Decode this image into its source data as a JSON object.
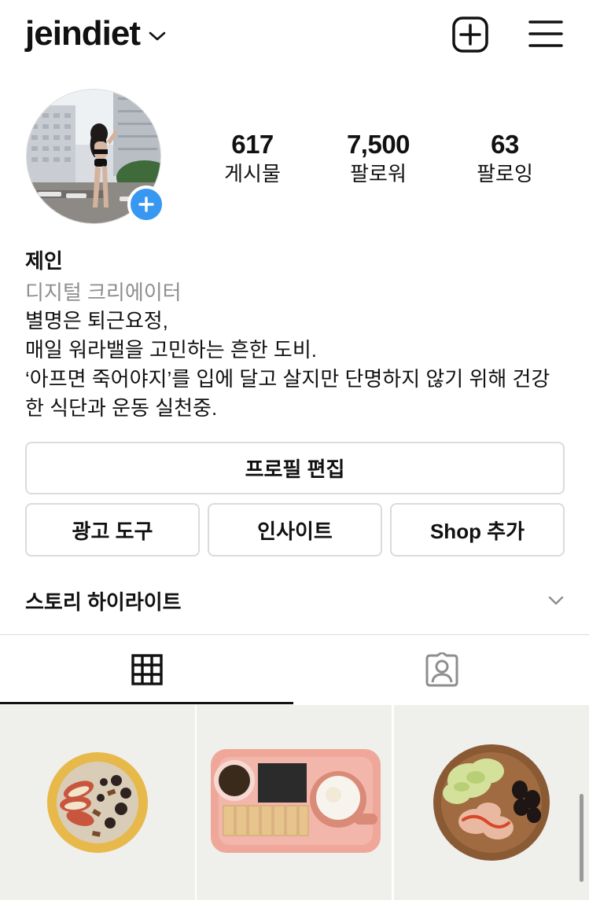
{
  "header": {
    "username": "jeindiet"
  },
  "stats": {
    "posts": {
      "value": "617",
      "label": "게시물"
    },
    "followers": {
      "value": "7,500",
      "label": "팔로워"
    },
    "following": {
      "value": "63",
      "label": "팔로잉"
    }
  },
  "bio": {
    "name": "제인",
    "category": "디지털 크리에이터",
    "lines": [
      "별명은 퇴근요정,",
      "매일 워라밸을 고민하는 흔한 도비.",
      "‘아프면 죽어야지’를 입에 달고 살지만 단명하지 않기 위해 건강",
      "한 식단과 운동 실천중."
    ]
  },
  "buttons": {
    "edit_profile": "프로필 편집",
    "ad_tools": "광고 도구",
    "insights": "인사이트",
    "add_shop": "Shop 추가"
  },
  "highlights": {
    "label": "스토리 하이라이트"
  },
  "colors": {
    "accent_blue": "#3897f0",
    "border": "#dbdbdb",
    "muted_text": "#8e8e8e"
  },
  "icons": {
    "chevron": "chevron-down-icon",
    "new_post": "plus-square-icon",
    "menu": "hamburger-menu-icon",
    "grid_tab": "grid-icon",
    "tagged_tab": "tagged-person-icon"
  }
}
